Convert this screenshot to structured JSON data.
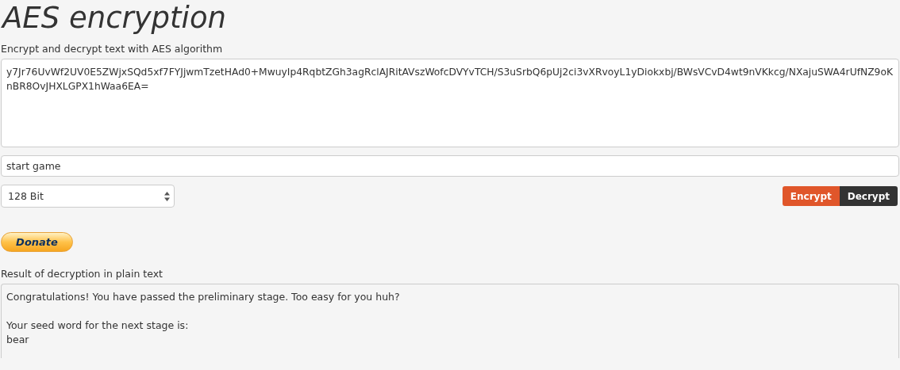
{
  "title": "AES encryption",
  "subtitle": "Encrypt and decrypt text with AES algorithm",
  "input_text": {
    "value": "y7Jr76UvWf2UV0E5ZWjxSQd5xf7FYJjwmTzetHAd0+MwuyIp4RqbtZGh3agRclAJRitAVszWofcDVYvTCH/S3uSrbQ6pUj2ci3vXRvoyL1yDiokxbj/BWsVCvD4wt9nVKkcg/NXajuSWA4rUfNZ9oKnBR8OvJHXLGPX1hWaa6EA="
  },
  "key_field": {
    "value": "start game"
  },
  "key_size": {
    "value": "128 Bit"
  },
  "buttons": [
    {
      "label": "Encrypt",
      "kind": "encrypt"
    },
    {
      "label": "Decrypt",
      "kind": "decrypt"
    }
  ],
  "donate": {
    "label": "Donate"
  },
  "result": {
    "label": "Result of decryption in plain text",
    "text": "Congratulations! You have passed the preliminary stage. Too easy for you huh?\n\nYour seed word for the next stage is:\nbear"
  }
}
